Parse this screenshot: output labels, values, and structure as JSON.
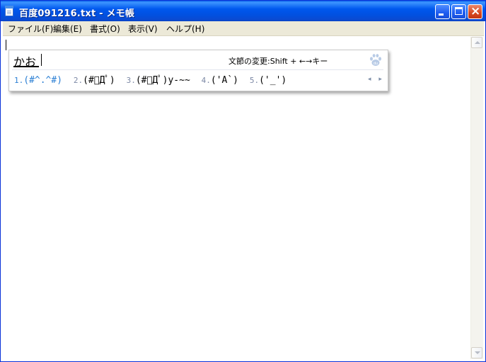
{
  "window": {
    "title": "百度091216.txt - メモ帳",
    "buttons": {
      "minimize": "minimize",
      "maximize": "maximize",
      "close": "×"
    }
  },
  "menu": {
    "items": [
      "ファイル(F)",
      "編集(E)",
      "書式(O)",
      "表示(V)",
      "ヘルプ(H)"
    ]
  },
  "editor": {
    "content": ""
  },
  "ime": {
    "composition": "かお",
    "hint": "文節の変更:Shift + ←→キー",
    "logo_icon": "baidu-paw-icon",
    "candidates": [
      {
        "num": "1.",
        "text": "(#^.^#)",
        "selected": true
      },
      {
        "num": "2.",
        "text": "(#ﾟДﾟ)"
      },
      {
        "num": "3.",
        "text": "(#ﾟДﾟ)y-~~"
      },
      {
        "num": "4.",
        "text": "('A`)"
      },
      {
        "num": "5.",
        "text": "('_')"
      }
    ],
    "pager": "◂ ▸"
  },
  "colors": {
    "titlebar": "#0058ee",
    "selected_candidate": "#2b7fd4",
    "menubar": "#ece9d8"
  }
}
